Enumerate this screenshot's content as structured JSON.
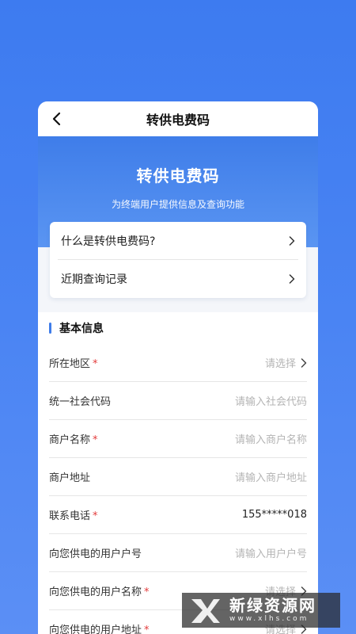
{
  "header": {
    "title": "转供电费码"
  },
  "hero": {
    "title": "转供电费码",
    "subtitle": "为终端用户提供信息及查询功能"
  },
  "links": [
    {
      "label": "什么是转供电费码?"
    },
    {
      "label": "近期查询记录"
    }
  ],
  "section": {
    "title": "基本信息"
  },
  "fields": [
    {
      "label": "所在地区",
      "required": "*",
      "value": "请选择",
      "has_arrow": true,
      "filled": false
    },
    {
      "label": "统一社会代码",
      "required": "",
      "value": "请输入社会代码",
      "has_arrow": false,
      "filled": false
    },
    {
      "label": "商户名称",
      "required": "*",
      "value": "请输入商户名称",
      "has_arrow": false,
      "filled": false
    },
    {
      "label": "商户地址",
      "required": "",
      "value": "请输入商户地址",
      "has_arrow": false,
      "filled": false
    },
    {
      "label": "联系电话",
      "required": "*",
      "value": "155*****018",
      "has_arrow": false,
      "filled": true
    },
    {
      "label": "向您供电的用户户号",
      "required": "",
      "value": "请输入用户户号",
      "has_arrow": false,
      "filled": false
    },
    {
      "label": "向您供电的用户名称",
      "required": "*",
      "value": "请选择",
      "has_arrow": true,
      "filled": false
    },
    {
      "label": "向您供电的用户地址",
      "required": "*",
      "value": "请选择",
      "has_arrow": true,
      "filled": false
    }
  ],
  "watermark": {
    "text": "新绿资源网",
    "domain": "www.xlhs.com"
  },
  "colors": {
    "background": "#4a84f3",
    "accent": "#3e7ce9",
    "required": "#e23b3b",
    "placeholder": "#b4b4b4"
  }
}
